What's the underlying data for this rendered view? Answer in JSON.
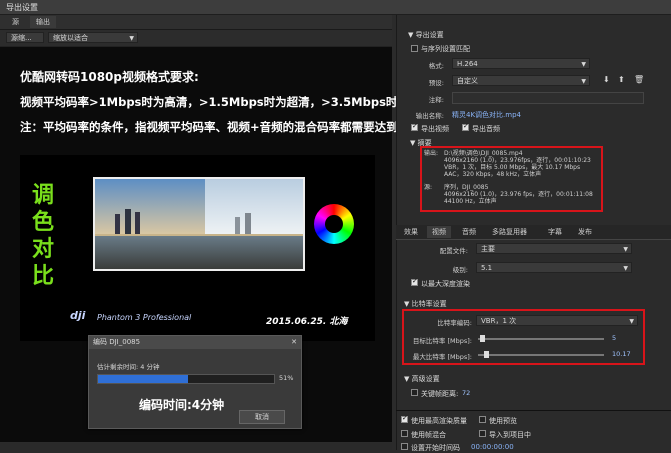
{
  "window": {
    "title": "导出设置"
  },
  "left_tabs": [
    "源",
    "输出"
  ],
  "toolbar": {
    "source_label": "源缩...",
    "zoom": "缩放以适合"
  },
  "notes": [
    "优酷网转码1080p视频格式要求:",
    "视频平均码率>1Mbps时为高清，>1.5Mbps时为超清，>3.5Mbps时为1080p.",
    "注：平均码率的条件，指视频平均码率、视频+音频的混合码率都需要达到要求."
  ],
  "video": {
    "title_text": "调色对比",
    "brand": "dji",
    "model": "Phantom 3 Professional",
    "date": "2015.06.25. 北海"
  },
  "dialog": {
    "title": "编码 DJI_0085",
    "remaining": "估计剩余时间: 4 分钟",
    "progress": 0.51,
    "progress_label": "51%",
    "encode_time": "编码时间:4分钟",
    "cancel": "取消"
  },
  "export": {
    "section": "导出设置",
    "match_sequence": "与序列设置匹配",
    "format_label": "格式:",
    "format_value": "H.264",
    "preset_label": "预设:",
    "preset_value": "自定义",
    "comment_label": "注释:",
    "output_name_label": "输出名称:",
    "output_name_value": "精灵4K调色对比.mp4",
    "export_video": "导出视频",
    "export_audio": "导出音频",
    "summary_title": "摘要",
    "output_prefix": "输出:",
    "output_lines": [
      "D:\\视频\\调色\\DJI_0085.mp4",
      "4096x2160 (1.0)，23.976fps，逐行，00:01:10:23",
      "VBR，1 次，目标 5.00 Mbps，最大 10.17 Mbps",
      "AAC，320 Kbps，48 kHz，立体声"
    ],
    "source_prefix": "源:",
    "source_lines": [
      "序列，DJI_0085",
      "4096x2160 (1.0)，23.976 fps，逐行，00:01:11:08",
      "44100 Hz，立体声"
    ]
  },
  "right_tabs": [
    "效果",
    "视频",
    "音频",
    "多路复用器",
    "字幕",
    "发布"
  ],
  "video_settings": {
    "profile_label": "配置文件:",
    "profile_value": "主要",
    "level_label": "级别:",
    "level_value": "5.1",
    "max_depth": "以最大深度渲染",
    "bitrate_section": "比特率设置",
    "encoding_label": "比特率编码:",
    "encoding_value": "VBR，1 次",
    "target_label": "目标比特率 [Mbps]:",
    "target_value": "5",
    "max_label": "最大比特率 [Mbps]:",
    "max_value": "10.17",
    "advanced_section": "高级设置",
    "keyframe_label": "关键帧距离:",
    "keyframe_value": "72"
  },
  "bottom_options": {
    "max_render_quality": "使用最高渲染质量",
    "use_preview": "使用预览",
    "use_frame_blend": "使用帧混合",
    "import_project": "导入到项目中",
    "start_time": "设置开始时间码",
    "start_time_value": "00:00:00:00"
  },
  "colors": {
    "accent_red": "#d8141a",
    "green_title": "#7adf1c",
    "progress_blue": "#2f6fd6"
  }
}
